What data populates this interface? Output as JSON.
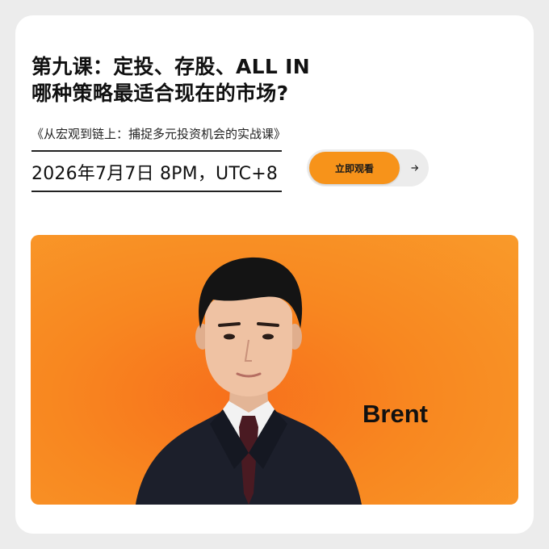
{
  "course": {
    "title_line1": "第九课：定投、存股、ALL IN",
    "title_line2": "哪种策略最适合现在的市场?",
    "series": "《从宏观到链上：捕捉多元投资机会的实战课》",
    "datetime": "2026年7月7日 8PM，UTC+8"
  },
  "cta": {
    "label": "立即观看",
    "icon": "arrow-right-icon"
  },
  "speaker": {
    "name": "Brent"
  },
  "colors": {
    "accent": "#f7931a",
    "banner": "#f88720",
    "card": "#ffffff",
    "background": "#ececec"
  }
}
